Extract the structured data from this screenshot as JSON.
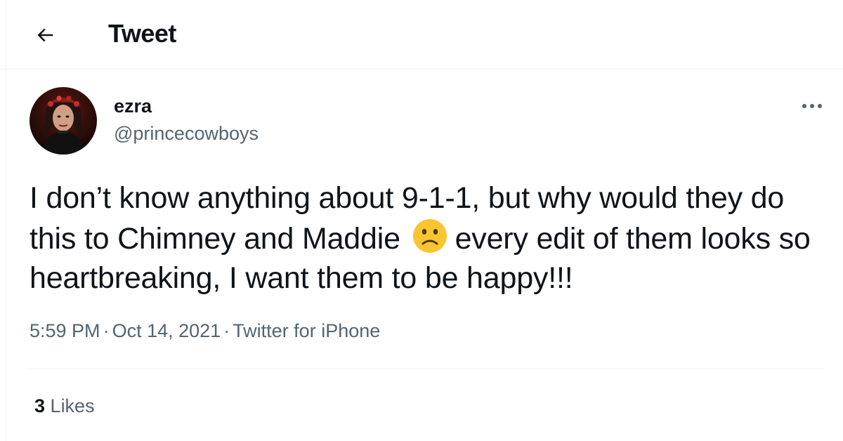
{
  "header": {
    "title": "Tweet",
    "back_icon": "arrow-left-icon"
  },
  "tweet": {
    "author": {
      "display_name": "ezra",
      "handle": "@princecowboys",
      "avatar_icon": "profile-photo"
    },
    "more_icon": "more-dots-icon",
    "text_before_emoji": "I don’t know anything about 9-1-1, but why would they do this to Chimney and Maddie",
    "emoji": "slightly-frowning-face-emoji",
    "text_after_emoji": "every edit of them looks so heartbreaking, I want them to be happy!!!",
    "time": "5:59 PM",
    "date": "Oct 14, 2021",
    "source": "Twitter for iPhone",
    "separator": "·",
    "likes_count": "3",
    "likes_label": "Likes"
  },
  "colors": {
    "text": "#0f1419",
    "secondary": "#536471",
    "border": "#eff3f4",
    "emoji_face": "#fbc531"
  }
}
